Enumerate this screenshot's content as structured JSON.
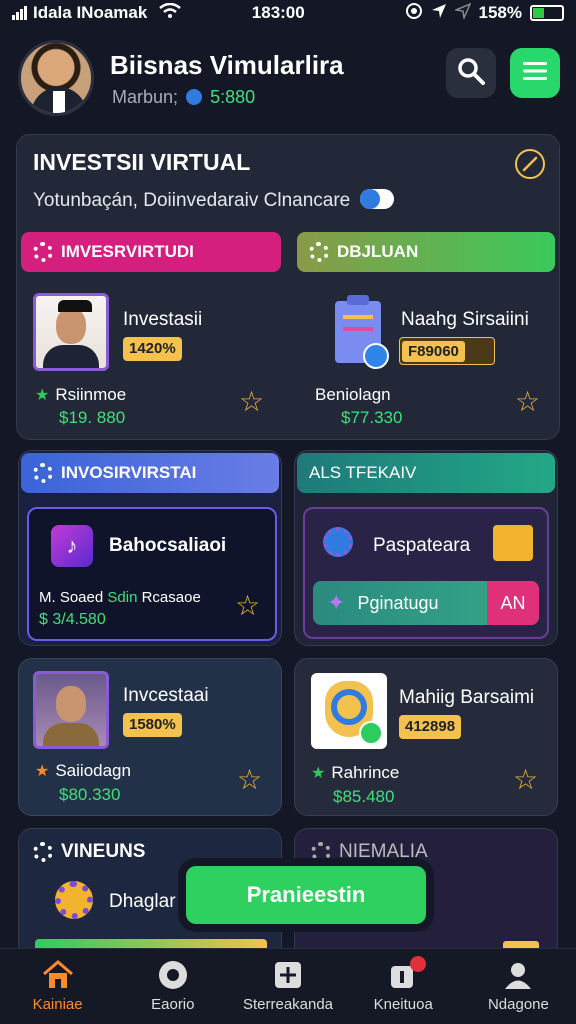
{
  "status": {
    "carrier": "Idala INoamak",
    "time": "183:00",
    "battery": "158%"
  },
  "header": {
    "title": "Biisnas Vimularlira",
    "subtitle": "Marbun;",
    "balance": "5:880"
  },
  "panel": {
    "title": "INVESTSII VIRTUAL",
    "subtitle": "Yotunbaçán,  Doiinvedaraiv Clnancare"
  },
  "tabs": [
    {
      "label": "IMVESRVIRTUDI",
      "color": "#d51f7f"
    },
    {
      "label": "DBJLUAN",
      "color": "#5cc44a"
    }
  ],
  "row1": [
    {
      "name": "Investasii",
      "badge": "1420%",
      "label": "Rsiinmoe",
      "value": "$19. 880"
    },
    {
      "name": "Naahg Sirsaiini",
      "badge": "F89060",
      "label": "Beniolagn",
      "value": "$77.330"
    }
  ],
  "sections": [
    {
      "title": "INVOSIRVIRSTAI",
      "item": "Bahocsaliaoi",
      "label_a": "M. Soaed",
      "label_b": "Sdin",
      "label_c": "Rcasaoe",
      "value": "$ 3/4.580"
    },
    {
      "title": "ALS TFEKAIV",
      "item": "Paspateara",
      "action": "Pginatugu",
      "action_tag": "AN"
    }
  ],
  "row2": [
    {
      "name": "Invcestaai",
      "badge": "1580%",
      "label": "Saiiodagn",
      "value": "$80.330"
    },
    {
      "name": "Mahiig Barsaimi",
      "badge": "412898",
      "label": "Rahrince",
      "value": "$85.480"
    }
  ],
  "lower": [
    {
      "title": "VINEUNS",
      "item": "Dhaglar"
    },
    {
      "title": "NIEMALIA"
    }
  ],
  "cta": "Pranieestin",
  "nav": [
    "Kainiae",
    "Eaorio",
    "Sterreakanda",
    "Kneituoa",
    "Ndagone"
  ],
  "colors": {
    "accent": "#2ed160",
    "warn": "#f2c14e",
    "active": "#ff8a2a"
  }
}
